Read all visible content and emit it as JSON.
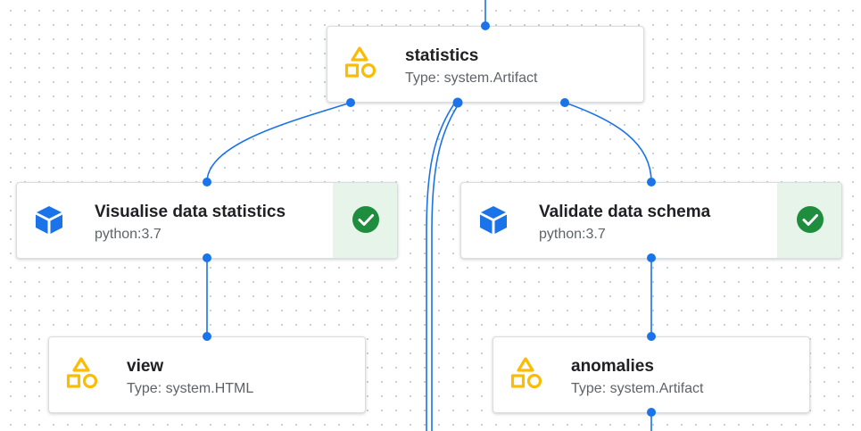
{
  "colors": {
    "edge": "#1a73e8",
    "artifact_icon": "#fbbc04",
    "execution_icon": "#1a73e8",
    "success": "#1e8e3e",
    "success_bg": "#e6f4ea"
  },
  "nodes": {
    "statistics": {
      "title": "statistics",
      "subtitle": "Type: system.Artifact",
      "icon": "artifact-shapes-icon"
    },
    "visualise": {
      "title": "Visualise data statistics",
      "subtitle": "python:3.7",
      "icon": "cube-icon",
      "status": "success-check-icon"
    },
    "validate": {
      "title": "Validate data schema",
      "subtitle": "python:3.7",
      "icon": "cube-icon",
      "status": "success-check-icon"
    },
    "view": {
      "title": "view",
      "subtitle": "Type: system.HTML",
      "icon": "artifact-shapes-icon"
    },
    "anomalies": {
      "title": "anomalies",
      "subtitle": "Type: system.Artifact",
      "icon": "artifact-shapes-icon"
    }
  }
}
